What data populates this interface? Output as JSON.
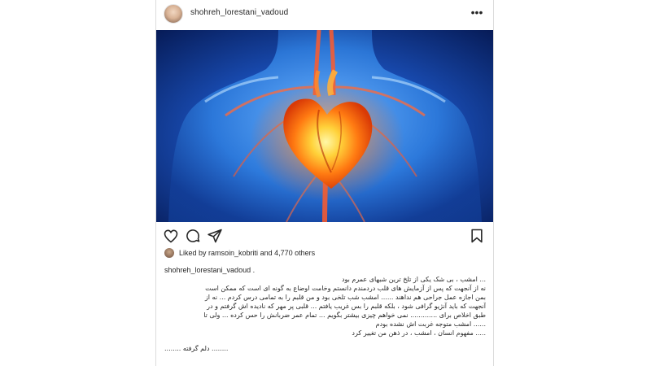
{
  "post": {
    "username": "shohreh_lorestani_vadoud",
    "more_icon": "more-horizontal-icon",
    "image_subject": "human-heart-anatomy-illustration",
    "actions": {
      "like_icon": "heart-outline-icon",
      "comment_icon": "comment-icon",
      "share_icon": "paper-plane-icon",
      "save_icon": "bookmark-icon"
    },
    "likes": {
      "prefix": "Liked by ",
      "user": "ramsoin_kobriti",
      "suffix": " and 4,770 others"
    },
    "caption": {
      "user": "shohreh_lorestani_vadoud .",
      "lines": [
        "... امشب ، بی شک یکی از تلخ ترین شبهای عمرم بود",
        "نه از آنجهت که پس از آزمایش های قلب دردمندم دانستم وخامت اوضاع به گونه ای است که ممکن است",
        "بمن اجازه عمل جراحی هم نداهند ...... امشب شب تلخی بود و من قلبم را به تمامی درس کردم ... نه از",
        "آنجهت که باید آنژیو گرافی شود ، بلکه قلبم را بس غریب یافتم ... قلبی پر مهر که نادیده اش گرفتم و در",
        "طبق اخلاص برای ............. نمی خواهم چیزی بیشتر بگویم ... تمام عمر ضربانش را حس کرده ... ولی تا",
        "...... امشب متوجه غربت اش نشده بودم",
        "..... مفهوم انسان ، امشب ، در ذهن من تغییر کرد",
        "",
        "........ دلم گرفته ........"
      ]
    }
  }
}
